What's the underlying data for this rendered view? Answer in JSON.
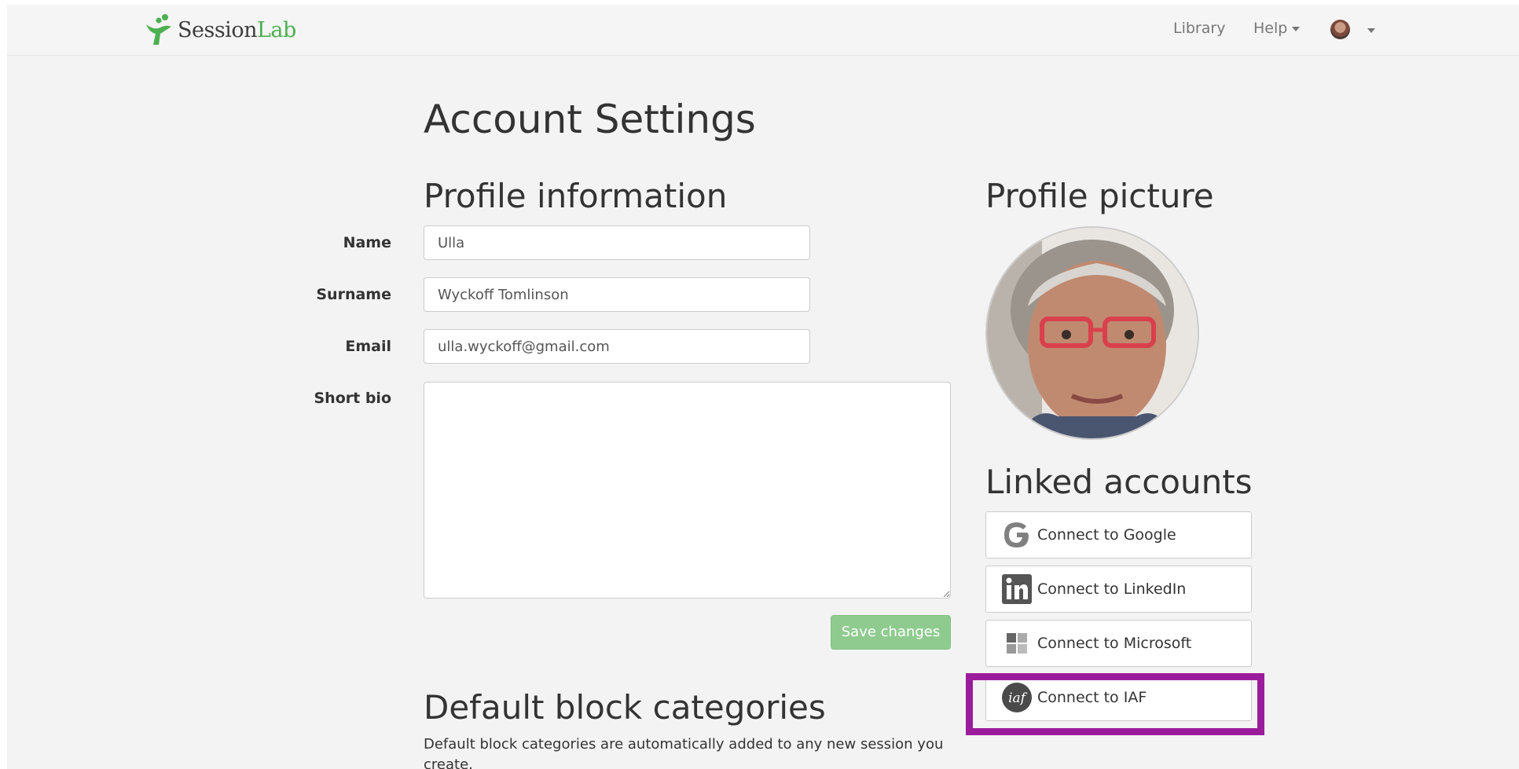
{
  "navbar": {
    "logo_session": "Session",
    "logo_lab": "Lab",
    "library": "Library",
    "help": "Help"
  },
  "page": {
    "title": "Account Settings"
  },
  "profile_info": {
    "heading": "Profile information",
    "name_label": "Name",
    "name_value": "Ulla",
    "surname_label": "Surname",
    "surname_value": "Wyckoff Tomlinson",
    "email_label": "Email",
    "email_value": "ulla.wyckoff@gmail.com",
    "bio_label": "Short bio",
    "bio_value": "",
    "save_label": "Save changes"
  },
  "profile_picture": {
    "heading": "Profile picture"
  },
  "linked_accounts": {
    "heading": "Linked accounts",
    "google": "Connect to Google",
    "linkedin": "Connect to LinkedIn",
    "microsoft": "Connect to Microsoft",
    "iaf": "Connect to IAF"
  },
  "default_blocks": {
    "heading": "Default block categories",
    "description": "Default block categories are automatically added to any new session you create."
  },
  "colors": {
    "brand_green": "#4caf50",
    "save_button": "#8fcb8f",
    "highlight": "#9b1c9b"
  }
}
